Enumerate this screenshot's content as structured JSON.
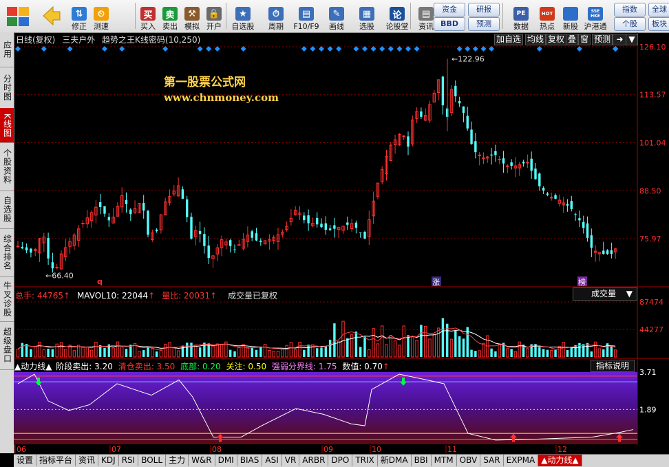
{
  "toolbar": {
    "buttons": [
      {
        "label": "修正",
        "icon": "arrows-updown-icon"
      },
      {
        "label": "测速",
        "icon": "speed-icon"
      },
      {
        "label": "买入",
        "icon": "buy-icon"
      },
      {
        "label": "卖出",
        "icon": "sell-icon"
      },
      {
        "label": "模拟",
        "icon": "hammer-icon"
      },
      {
        "label": "开户",
        "icon": "lock-icon"
      },
      {
        "label": "自选股",
        "icon": "star-folder-icon"
      },
      {
        "label": "周期",
        "icon": "clock-icon"
      },
      {
        "label": "F10/F9",
        "icon": "f10-icon"
      },
      {
        "label": "画线",
        "icon": "pencil-icon"
      },
      {
        "label": "选股",
        "icon": "screen-icon"
      },
      {
        "label": "论股堂",
        "icon": "discuss-icon"
      },
      {
        "label": "资讯",
        "icon": "news-icon"
      },
      {
        "label": "数据",
        "icon": "pe-icon"
      },
      {
        "label": "热点",
        "icon": "fire-icon"
      },
      {
        "label": "新股",
        "icon": "newstock-icon"
      },
      {
        "label": "沪港通",
        "icon": "sse-hke-icon"
      }
    ],
    "buy_char": "买",
    "sell_char": "卖",
    "pe_text": "PE",
    "hot_text": "HOT",
    "sse_text": "SSE HKE",
    "small": {
      "zijin": "资金",
      "bbd": "BBD",
      "yanbao": "研报",
      "yuce": "预测",
      "zhishu": "指数",
      "gegu": "个股",
      "quanqiu": "全球",
      "banku": "板块"
    }
  },
  "left_tabs": [
    "应用",
    "分时图",
    "K线图",
    "个股资料",
    "自选股",
    "综合排名",
    "牛叉诊股",
    "超级盘口"
  ],
  "header": {
    "period": "日线(复权)",
    "stock": "三夫户外",
    "indicator": "趋势之王K线密码(10,250)",
    "right_buttons": [
      "加自选",
      "均线",
      "复权",
      "叠",
      "窗",
      "预测"
    ]
  },
  "watermark": {
    "title": "第一股票公式网",
    "url": "www.chnmoney.com"
  },
  "price_axis": [
    "126.10",
    "113.57",
    "101.04",
    "88.50",
    "75.97"
  ],
  "annotations": {
    "high": "122.96",
    "low": "66.40",
    "mark_q": "q",
    "mark_zhang": "涨",
    "mark_bang": "榜"
  },
  "volume_header": {
    "total": "总手: 44765",
    "mavol": "MAVOL10: 22044",
    "ratio": "量比: 20031",
    "note": "成交量已复权",
    "selector": "成交量"
  },
  "volume_axis": [
    "87474",
    "44277"
  ],
  "power_header": {
    "name": "▲动力线▲",
    "s1": "阶段卖出: 3.20",
    "s2": "清仓卖出: 3.50",
    "s3": "底部: 0.20",
    "s4": "关注: 0.50",
    "s5": "强弱分界线: 1.75",
    "s6": "数值: 0.70",
    "help": "指标说明"
  },
  "power_axis": [
    "3.71",
    "1.89"
  ],
  "months": [
    "06",
    "07",
    "08",
    "09",
    "10",
    "11",
    "12"
  ],
  "bottom_tabs": [
    "设置",
    "指标平台",
    "资讯",
    "KDJ",
    "RSI",
    "BOLL",
    "主力",
    "W&R",
    "DMI",
    "BIAS",
    "ASI",
    "VR",
    "ARBR",
    "DPO",
    "TRIX",
    "新DMA",
    "BBI",
    "MTM",
    "OBV",
    "SAR",
    "EXPMA",
    "▲动力线▲"
  ],
  "colors": {
    "up": "#ff3030",
    "down": "#54ffff",
    "grid": "#8a0000",
    "axis_text": "#ff3030",
    "diamond": "#1e90ff",
    "watermark": "#ffd24a"
  },
  "chart_data": {
    "type": "candlestick",
    "price_high": 122.96,
    "price_low": 66.4,
    "volume_max_label": 87474,
    "power_levels": {
      "sell_stage": 3.2,
      "sell_all": 3.5,
      "bottom": 0.2,
      "watch": 0.5,
      "divider": 1.75,
      "value": 0.7
    }
  }
}
